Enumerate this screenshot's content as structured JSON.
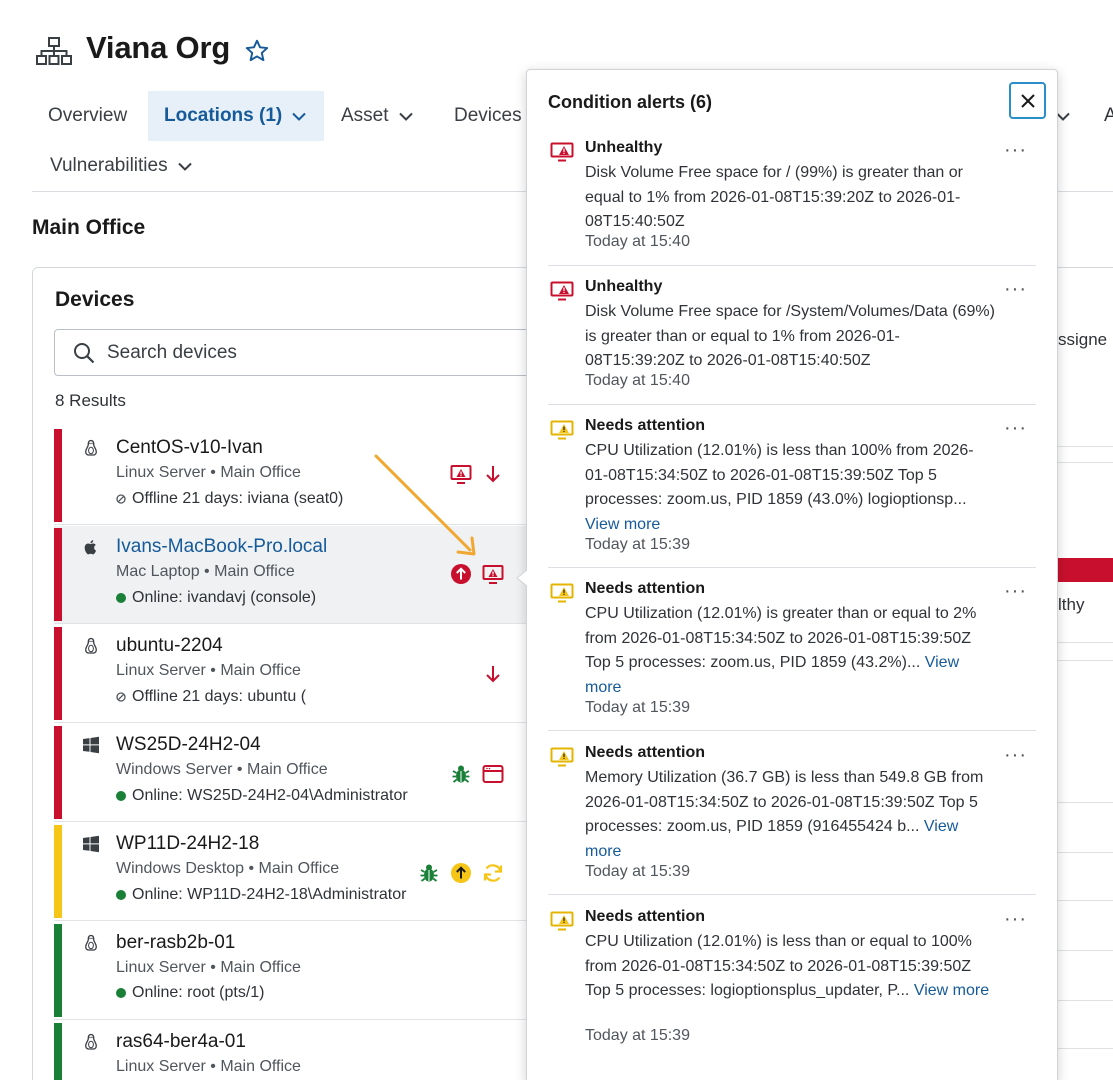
{
  "header": {
    "org_name": "Viana Org"
  },
  "tabs": [
    {
      "label": "Overview"
    },
    {
      "label": "Locations (1)"
    },
    {
      "label": "Asset"
    },
    {
      "label": "Devices"
    },
    {
      "label": "Vulnerabilities"
    }
  ],
  "location": {
    "title": "Main Office"
  },
  "devices": {
    "title": "Devices",
    "search_placeholder": "Search devices",
    "results": "8 Results",
    "rows": [
      {
        "name": "CentOS-v10-Ivan",
        "type": "Linux Server",
        "location": "Main Office",
        "status": "Offline 21 days: iviana (seat0)"
      },
      {
        "name": "Ivans-MacBook-Pro.local",
        "type": "Mac Laptop",
        "location": "Main Office",
        "status": "Online: ivandavj (console)"
      },
      {
        "name": "ubuntu-2204",
        "type": "Linux Server",
        "location": "Main Office",
        "status": "Offline 21 days: ubuntu ("
      },
      {
        "name": "WS25D-24H2-04",
        "type": "Windows Server",
        "location": "Main Office",
        "status": "Online: WS25D-24H2-04\\Administrator"
      },
      {
        "name": "WP11D-24H2-18",
        "type": "Windows Desktop",
        "location": "Main Office",
        "status": "Online: WP11D-24H2-18\\Administrator"
      },
      {
        "name": "ber-rasb2b-01",
        "type": "Linux Server",
        "location": "Main Office",
        "status": "Online: root (pts/1)"
      },
      {
        "name": "ras64-ber4a-01",
        "type": "Linux Server",
        "location": "Main Office",
        "status": ""
      }
    ]
  },
  "background_fragments": {
    "assigned": "ssigne",
    "healthy": "lthy",
    "edge_letter": "A"
  },
  "popover": {
    "title": "Condition alerts (6)",
    "alerts": [
      {
        "title": "Unhealthy",
        "text": "Disk Volume Free space for / (99%) is greater than or equal to 1% from 2026-01-08T15:39:20Z to 2026-01-08T15:40:50Z",
        "link": "",
        "time": "Today at 15:40"
      },
      {
        "title": "Unhealthy",
        "text": "Disk Volume Free space for /System/Volumes/Data (69%) is greater than or equal to 1% from 2026-01-08T15:39:20Z to 2026-01-08T15:40:50Z",
        "link": "",
        "time": "Today at 15:40"
      },
      {
        "title": "Needs attention",
        "text": "CPU Utilization (12.01%) is less than 100% from 2026-01-08T15:34:50Z to 2026-01-08T15:39:50Z Top 5 processes: zoom.us, PID 1859 (43.0%) logioptionsp...",
        "link": "View more",
        "time": "Today at 15:39"
      },
      {
        "title": "Needs attention",
        "text": "CPU Utilization (12.01%) is greater than or equal to 2% from 2026-01-08T15:34:50Z to 2026-01-08T15:39:50Z Top 5 processes: zoom.us, PID 1859 (43.2%)...",
        "link": "View more",
        "time": "Today at 15:39"
      },
      {
        "title": "Needs attention",
        "text": "Memory Utilization (36.7 GB) is less than 549.8 GB from 2026-01-08T15:34:50Z to 2026-01-08T15:39:50Z Top 5 processes: zoom.us, PID 1859 (916455424 b...",
        "link": "View more",
        "time": "Today at 15:39"
      },
      {
        "title": "Needs attention",
        "text": "CPU Utilization (12.01%) is less than or equal to 100% from 2026-01-08T15:34:50Z to 2026-01-08T15:39:50Z Top 5 processes: logioptionsplus_updater, P...",
        "link": "View more",
        "time": "Today at 15:39"
      }
    ],
    "more_label": "···"
  },
  "colors": {
    "critical": "#c8102e",
    "warning": "#f5c518",
    "healthy": "#1a7f37",
    "link": "#165a9a",
    "accent": "#2a8fc8"
  }
}
